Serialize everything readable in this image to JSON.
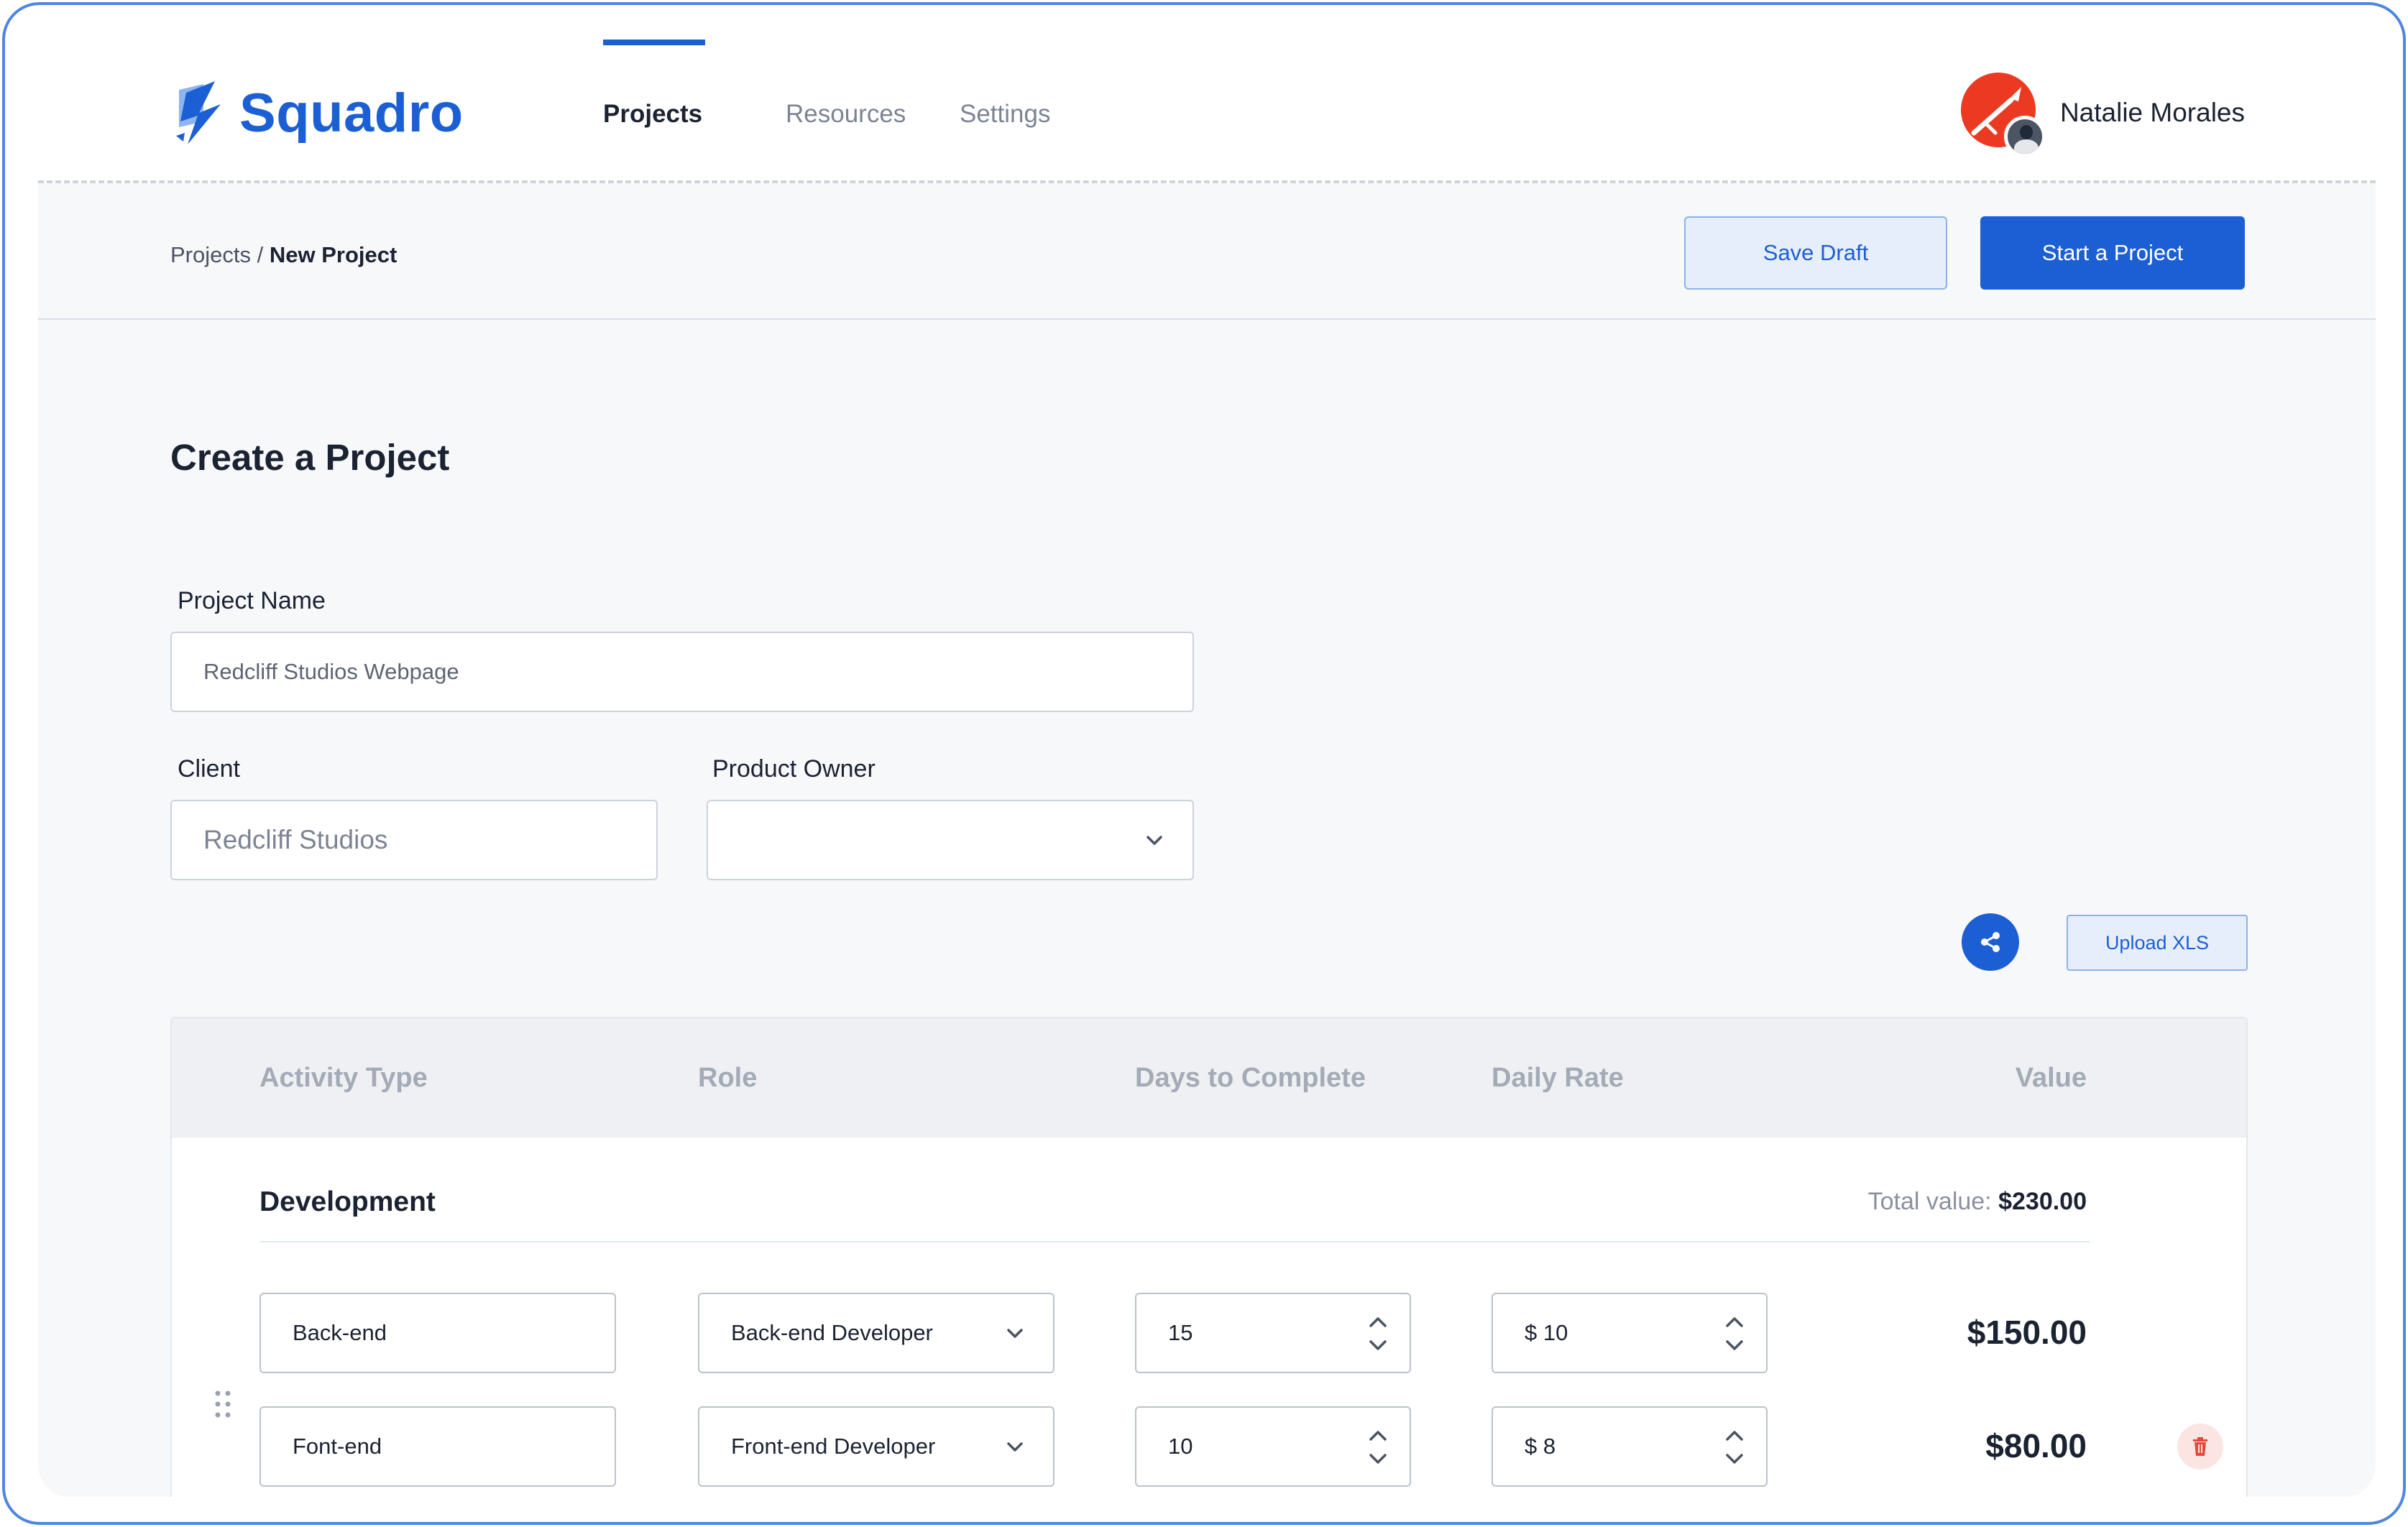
{
  "app": {
    "name": "Squadro"
  },
  "nav": {
    "links": [
      {
        "label": "Projects",
        "active": true
      },
      {
        "label": "Resources",
        "active": false
      },
      {
        "label": "Settings",
        "active": false
      }
    ]
  },
  "user": {
    "name": "Natalie Morales"
  },
  "breadcrumb": {
    "parent": "Projects",
    "separator": "/",
    "current": "New Project"
  },
  "actions": {
    "save_draft": "Save Draft",
    "start_project": "Start a Project"
  },
  "page": {
    "title": "Create a Project"
  },
  "form": {
    "project_name": {
      "label": "Project Name",
      "value": "Redcliff Studios Webpage"
    },
    "client": {
      "label": "Client",
      "placeholder": "Redcliff Studios"
    },
    "product_owner": {
      "label": "Product Owner",
      "value": ""
    }
  },
  "tools": {
    "share_icon": "share-icon",
    "upload_label": "Upload XLS"
  },
  "table": {
    "headers": [
      "Activity Type",
      "Role",
      "Days to Complete",
      "Daily Rate",
      "Value"
    ],
    "group": {
      "title": "Development",
      "total_label": "Total value:",
      "total_value": "$230.00",
      "rows": [
        {
          "activity": "Back-end",
          "role": "Back-end Developer",
          "days": "15",
          "rate": "$ 10",
          "value": "$150.00"
        },
        {
          "activity": "Font-end",
          "role": "Front-end Developer",
          "days": "10",
          "rate": "$ 8",
          "value": "$80.00"
        }
      ]
    }
  },
  "colors": {
    "accent": "#1c5fd4",
    "avatar": "#ec3a22",
    "danger": "#e5483a",
    "frame": "#4f86e0"
  }
}
